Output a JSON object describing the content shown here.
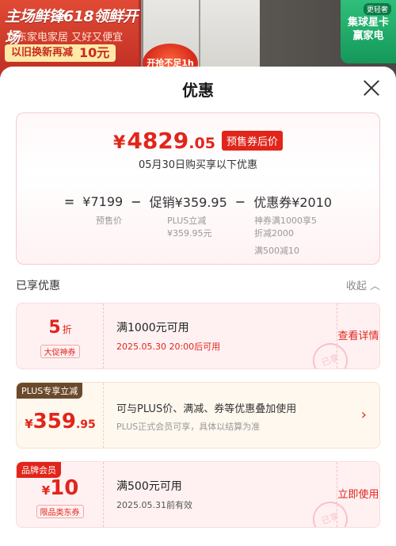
{
  "banner": {
    "title": "主场鲜锋618领鲜开场",
    "sub": "京东家电家居 又好又便宜",
    "promo": "以旧换新再减",
    "promo_amount": "10元",
    "badge_text": "开抢不足1h",
    "right_top": "更轻奢",
    "right_label": "集球星卡赢家电"
  },
  "sheet": {
    "title": "优惠"
  },
  "summary": {
    "yen": "¥",
    "price_int": "4829",
    "price_dec": ".05",
    "price_tag": "预售券后价",
    "date_line": "05月30日购买享以下优惠",
    "eq": "=",
    "base": "¥7199",
    "minus1": "−",
    "promo": "促销¥359.95",
    "minus2": "−",
    "coupon": "优惠券¥2010",
    "base_label": "预售价",
    "promo_detail": [
      "PLUS立减",
      "¥359.95元"
    ],
    "coupon_detail": [
      "神券满1000享5",
      "折减2000",
      "满500减10"
    ]
  },
  "section": {
    "title": "已享优惠",
    "collapse": "收起"
  },
  "cards": [
    {
      "big": "5",
      "unit": "折",
      "left_tag": "大促神券",
      "title": "满1000元可用",
      "sub": "2025.05.30 20:00后可用",
      "action": "查看详情",
      "stamp": "已享"
    },
    {
      "corner": "PLUS专享立减",
      "big_yen": "¥",
      "big": "359",
      "big_dec": ".95",
      "title": "可与PLUS价、满减、券等优惠叠加使用",
      "sub": "PLUS正式会员可享，具体以结算为准",
      "chevron": "›"
    },
    {
      "corner": "品牌会员",
      "big_yen": "¥",
      "big": "10",
      "left_tag": "限品类东券",
      "title": "满500元可用",
      "sub": "2025.05.31前有效",
      "action": "立即使用",
      "stamp": "已享"
    }
  ],
  "colors": {
    "accent": "#e1251b",
    "plus_tag": "#6b4a2c",
    "brand_tag": "#e1251b"
  }
}
